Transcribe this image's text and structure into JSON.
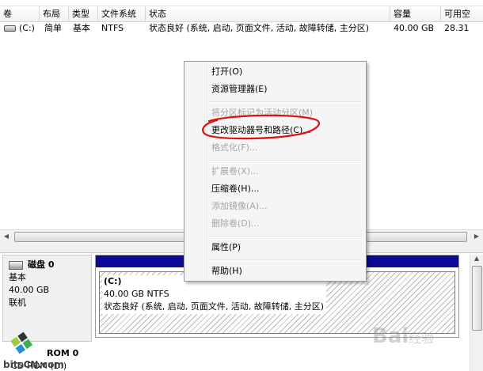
{
  "columns": [
    "卷",
    "布局",
    "类型",
    "文件系统",
    "状态",
    "容量",
    "可用空"
  ],
  "volume_row": {
    "volume": "(C:)",
    "layout": "简单",
    "type": "基本",
    "filesystem": "NTFS",
    "status": "状态良好 (系统, 启动, 页面文件, 活动, 故障转储, 主分区)",
    "capacity": "40.00 GB",
    "free": "28.31"
  },
  "context_menu": {
    "items": [
      {
        "label": "打开(O)",
        "enabled": true
      },
      {
        "label": "资源管理器(E)",
        "enabled": true
      },
      {
        "label": "将分区标记为活动分区(M)",
        "enabled": false
      },
      {
        "label": "更改驱动器号和路径(C)...",
        "enabled": true
      },
      {
        "label": "格式化(F)...",
        "enabled": false
      },
      {
        "label": "扩展卷(X)...",
        "enabled": false
      },
      {
        "label": "压缩卷(H)...",
        "enabled": true
      },
      {
        "label": "添加镜像(A)...",
        "enabled": false
      },
      {
        "label": "删除卷(D)...",
        "enabled": false
      },
      {
        "label": "属性(P)",
        "enabled": true
      },
      {
        "label": "帮助(H)",
        "enabled": true
      }
    ]
  },
  "disk0": {
    "title": "磁盘 0",
    "type": "基本",
    "size": "40.00 GB",
    "state": "联机",
    "partition": {
      "volume": "(C:)",
      "size_fs": "40.00 GB NTFS",
      "status": "状态良好 (系统, 启动, 页面文件, 活动, 故障转储, 主分区)"
    }
  },
  "cdrom": {
    "title": "ROM 0",
    "label": "CD-ROM (D:)"
  },
  "watermarks": {
    "left": "bitsCN.com",
    "right_main": "Bai",
    "right_sub": "经验"
  },
  "colors": {
    "partition_bar": "#0a0a96",
    "annotation": "#e01010"
  }
}
